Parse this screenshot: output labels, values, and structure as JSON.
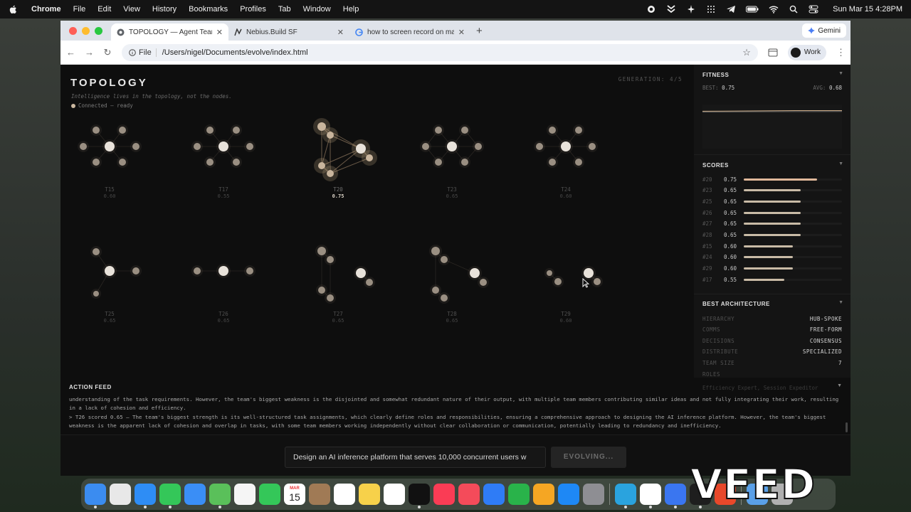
{
  "menubar": {
    "app": "Chrome",
    "items": [
      "File",
      "Edit",
      "View",
      "History",
      "Bookmarks",
      "Profiles",
      "Tab",
      "Window",
      "Help"
    ],
    "clock": "Sun Mar 15  4:28PM"
  },
  "browser": {
    "tabs": [
      {
        "label": "TOPOLOGY — Agent Team Ev",
        "icon": "chrome-page-icon"
      },
      {
        "label": "Nebius.Build SF",
        "icon": "nebius-icon"
      },
      {
        "label": "how to screen record on mac",
        "icon": "google-icon"
      }
    ],
    "gemini_label": "Gemini",
    "scheme_chip": "File",
    "url": "/Users/nigel/Documents/evolve/index.html",
    "profile_label": "Work"
  },
  "app": {
    "title": "TOPOLOGY",
    "subtitle": "Intelligence lives in the topology, not the nodes.",
    "status": "Connected — ready",
    "generation": "GENERATION: 4/5",
    "teams": [
      {
        "name": "T15",
        "score": "0.60"
      },
      {
        "name": "T17",
        "score": "0.55"
      },
      {
        "name": "T20",
        "score": "0.75"
      },
      {
        "name": "T23",
        "score": "0.65"
      },
      {
        "name": "T24",
        "score": "0.60"
      },
      {
        "name": "T25",
        "score": "0.65"
      },
      {
        "name": "T26",
        "score": "0.65"
      },
      {
        "name": "T27",
        "score": "0.65"
      },
      {
        "name": "T28",
        "score": "0.65"
      },
      {
        "name": "T29",
        "score": "0.60"
      }
    ]
  },
  "fitness": {
    "title": "FITNESS",
    "best_label": "BEST:",
    "best": "0.75",
    "avg_label": "AVG:",
    "avg": "0.68",
    "best_series": [
      0.7,
      0.72,
      0.75,
      0.75
    ],
    "avg_series": [
      0.64,
      0.66,
      0.67,
      0.68
    ]
  },
  "scores": {
    "title": "SCORES",
    "rows": [
      {
        "id": "#20",
        "value": "0.75",
        "fraction": 0.75
      },
      {
        "id": "#23",
        "value": "0.65",
        "fraction": 0.65
      },
      {
        "id": "#25",
        "value": "0.65",
        "fraction": 0.65
      },
      {
        "id": "#26",
        "value": "0.65",
        "fraction": 0.65
      },
      {
        "id": "#27",
        "value": "0.65",
        "fraction": 0.65
      },
      {
        "id": "#28",
        "value": "0.65",
        "fraction": 0.65
      },
      {
        "id": "#15",
        "value": "0.60",
        "fraction": 0.6
      },
      {
        "id": "#24",
        "value": "0.60",
        "fraction": 0.6
      },
      {
        "id": "#29",
        "value": "0.60",
        "fraction": 0.6
      },
      {
        "id": "#17",
        "value": "0.55",
        "fraction": 0.55
      }
    ]
  },
  "architecture": {
    "title": "BEST ARCHITECTURE",
    "rows": [
      {
        "key": "HIERARCHY",
        "value": "HUB-SPOKE"
      },
      {
        "key": "COMMS",
        "value": "FREE-FORM"
      },
      {
        "key": "DECISIONS",
        "value": "CONSENSUS"
      },
      {
        "key": "DISTRIBUTE",
        "value": "SPECIALIZED"
      },
      {
        "key": "TEAM SIZE",
        "value": "7"
      }
    ],
    "roles_label": "ROLES",
    "roles_value": "Efficiency Expert, Session Expeditor"
  },
  "feed": {
    "title": "ACTION FEED",
    "lines": [
      "understanding of the task requirements. However, the team's biggest weakness is the disjointed and somewhat redundant nature of their output, with multiple team members contributing similar ideas and not fully integrating their work, resulting in a lack of cohesion and efficiency.",
      "> T26 scored 0.65 — The team's biggest strength is its well-structured task assignments, which clearly define roles and responsibilities, ensuring a comprehensive approach to designing the AI inference platform. However, the team's biggest weakness is the apparent lack of cohesion and overlap in tasks, with some team members working independently without clear collaboration or communication, potentially leading to redundancy and inefficiency."
    ]
  },
  "input": {
    "value": "Design an AI inference platform that serves 10,000 concurrent users w",
    "button_label": "EVOLVING..."
  },
  "dock": {
    "calendar_month": "MAR",
    "calendar_day": "15",
    "apps": [
      "finder-icon",
      "launchpad-icon",
      "safari-icon",
      "messages-icon",
      "mail-icon",
      "maps-icon",
      "photos-icon",
      "facetime-icon",
      "calendar-icon",
      "contacts-icon",
      "reminders-icon",
      "notes-icon",
      "freeform-icon",
      "tv-icon",
      "music-icon",
      "news-icon",
      "keynote-icon",
      "numbers-icon",
      "pages-icon",
      "appstore-icon",
      "settings-icon",
      "telegram-icon",
      "chrome-icon",
      "signal-icon",
      "terminal-icon",
      "ai-icon",
      "folder-icon",
      "trash-icon"
    ]
  },
  "watermark": "VEED",
  "colors": {
    "accent": "#c9bba6",
    "best_bar": "#e0b89a",
    "node": "#9a8f82",
    "node_hub": "#e8e2da",
    "background": "#0e0e0e"
  }
}
